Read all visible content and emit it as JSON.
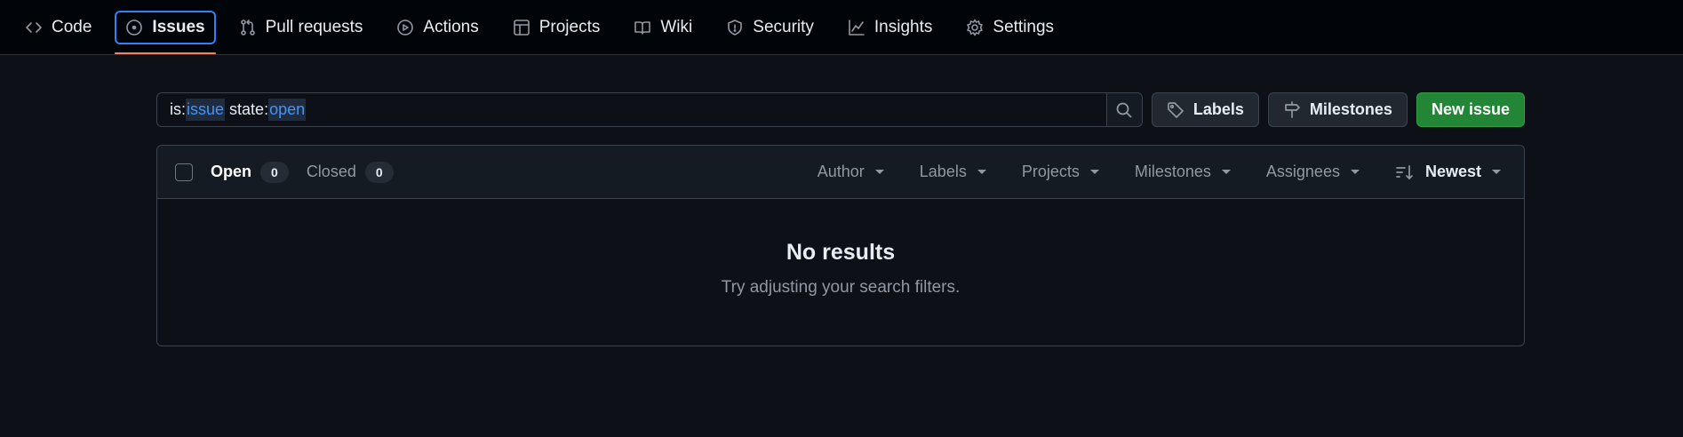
{
  "nav": {
    "items": [
      {
        "label": "Code",
        "icon": "code-icon"
      },
      {
        "label": "Issues",
        "icon": "issue-opened-icon",
        "active": true
      },
      {
        "label": "Pull requests",
        "icon": "git-pull-request-icon"
      },
      {
        "label": "Actions",
        "icon": "play-icon"
      },
      {
        "label": "Projects",
        "icon": "table-icon"
      },
      {
        "label": "Wiki",
        "icon": "book-icon"
      },
      {
        "label": "Security",
        "icon": "shield-icon"
      },
      {
        "label": "Insights",
        "icon": "graph-icon"
      },
      {
        "label": "Settings",
        "icon": "gear-icon"
      }
    ]
  },
  "search": {
    "query_parts": [
      {
        "key": "is:",
        "value": "issue"
      },
      {
        "key": "state:",
        "value": "open"
      }
    ]
  },
  "toolbar": {
    "labels_button": "Labels",
    "milestones_button": "Milestones",
    "new_issue_button": "New issue"
  },
  "issues": {
    "open_label": "Open",
    "open_count": "0",
    "closed_label": "Closed",
    "closed_count": "0",
    "filters": [
      "Author",
      "Labels",
      "Projects",
      "Milestones",
      "Assignees"
    ],
    "sort_label": "Newest"
  },
  "blankslate": {
    "title": "No results",
    "description": "Try adjusting your search filters."
  },
  "colors": {
    "accent": "#2f81f7",
    "active_underline": "#f78166",
    "primary_button": "#238636",
    "background": "#0d1117"
  }
}
